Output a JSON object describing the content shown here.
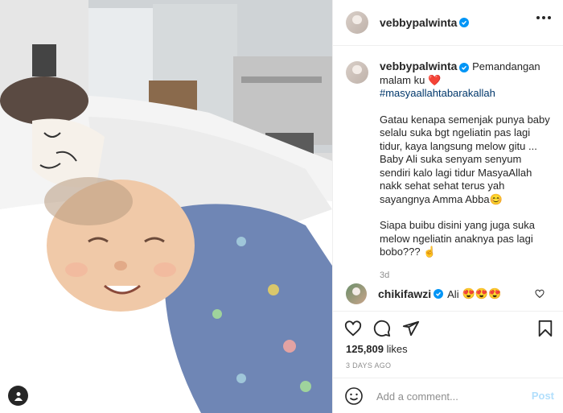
{
  "post": {
    "username": "vebbypalwinta",
    "verified": true,
    "caption_line1": "Pemandangan malam ku",
    "caption_heart": "❤️",
    "hashtag": "#masyaallahtabarakallah",
    "paragraph1": "Gatau kenapa semenjak punya baby selalu suka bgt ngeliatin pas lagi tidur, kaya langsung melow gitu ...",
    "paragraph2": "Baby Ali suka senyam senyum sendiri kalo lagi tidur MasyaAllah nakk sehat sehat terus yah sayangnya Amma Abba",
    "paragraph2_emoji": "😊",
    "paragraph3": "Siapa buibu disini yang juga suka melow ngeliatin anaknya pas lagi bobo???",
    "paragraph3_emoji": "☝️",
    "caption_age": "3d"
  },
  "comment": {
    "username": "chikifawzi",
    "text": "Ali",
    "emojis": "😍😍😍"
  },
  "actions": {
    "likes_count": "125,809",
    "likes_label": "likes",
    "date": "3 DAYS AGO"
  },
  "add_comment": {
    "placeholder": "Add a comment...",
    "post_label": "Post"
  },
  "icons": {
    "like": "heart-icon",
    "comment": "comment-icon",
    "share": "share-icon",
    "save": "bookmark-icon",
    "emoji": "emoji-icon",
    "more": "more-icon",
    "user_tag": "user-tag-icon",
    "verified": "verified-badge-icon"
  },
  "colors": {
    "accent": "#0095f6",
    "hashtag": "#00376b",
    "muted": "#8e8e8e",
    "post_disabled": "#b2dffc",
    "heart": "#ed4956"
  }
}
